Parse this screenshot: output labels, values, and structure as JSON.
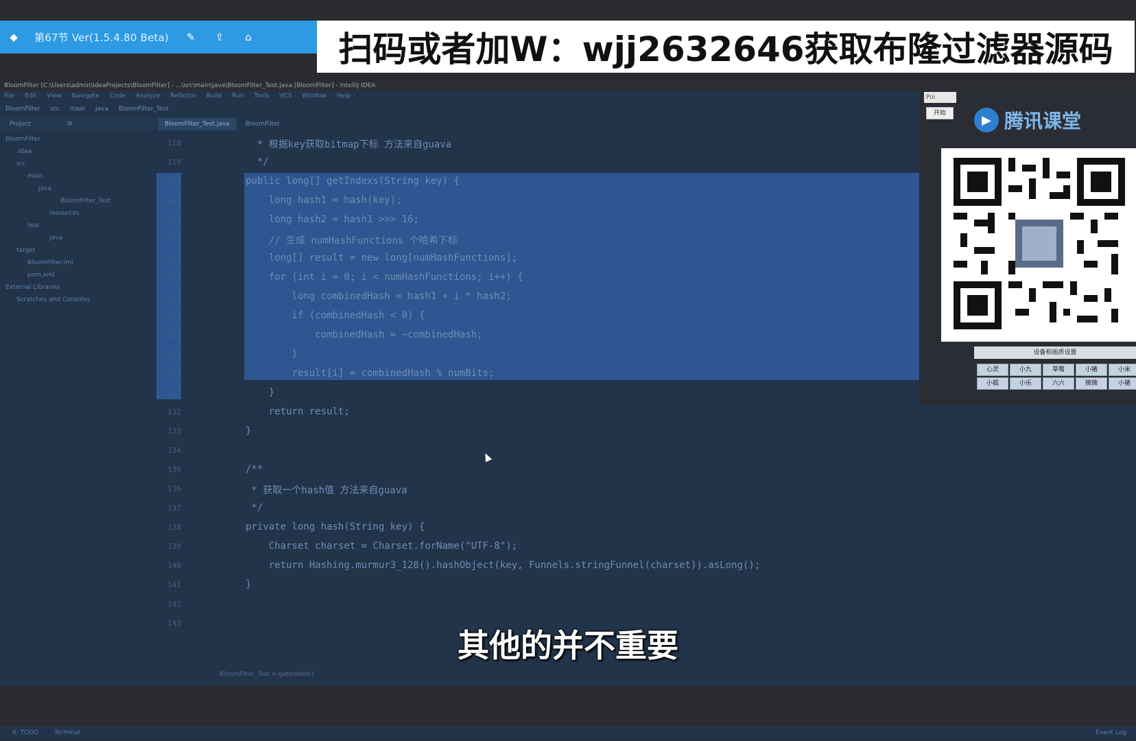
{
  "player": {
    "title": "第67节 Ver(1.5.4.80 Beta)",
    "icons": [
      "app-icon",
      "edit-icon",
      "share-icon",
      "home-icon"
    ]
  },
  "promo": {
    "text": "扫码或者加W：wjj2632646获取布隆过滤器源码"
  },
  "ide": {
    "window_title": "BloomFilter [C:\\Users\\admin\\IdeaProjects\\BloomFilter] - ...\\src\\main\\java\\BloomFilter_Test.java [BloomFilter] - IntelliJ IDEA",
    "menu": [
      "File",
      "Edit",
      "View",
      "Navigate",
      "Code",
      "Analyze",
      "Refactor",
      "Build",
      "Run",
      "Tools",
      "VCS",
      "Window",
      "Help"
    ],
    "breadcrumbs": [
      "BloomFilter",
      "src",
      "main",
      "java",
      "BloomFilter_Test"
    ],
    "project_header": "Project",
    "tabs": [
      {
        "label": "BloomFilter_Test.java",
        "active": true
      },
      {
        "label": "BloomFilter",
        "active": false
      }
    ],
    "tree": [
      {
        "label": "BloomFilter",
        "depth": 0
      },
      {
        "label": ".idea",
        "depth": 1
      },
      {
        "label": "src",
        "depth": 1
      },
      {
        "label": "main",
        "depth": 2
      },
      {
        "label": "java",
        "depth": 3
      },
      {
        "label": "BloomFilter_Test",
        "depth": 4
      },
      {
        "label": "resources",
        "depth": 3
      },
      {
        "label": "test",
        "depth": 2
      },
      {
        "label": "java",
        "depth": 3
      },
      {
        "label": "target",
        "depth": 1
      },
      {
        "label": "BloomFilter.iml",
        "depth": 1
      },
      {
        "label": "pom.xml",
        "depth": 1
      },
      {
        "label": "External Libraries",
        "depth": 0
      },
      {
        "label": "Scratches and Consoles",
        "depth": 0
      }
    ],
    "line_numbers": [
      "118",
      "119",
      "120",
      "121",
      "122",
      "123",
      "124",
      "125",
      "126",
      "127",
      "128",
      "129",
      "130",
      "131",
      "132",
      "133",
      "134",
      "135",
      "136",
      "137",
      "138",
      "139",
      "140",
      "141",
      "142",
      "143"
    ],
    "code_lines": [
      "  * 根据key获取bitmap下标 方法来自guava",
      "  */",
      "public long[] getIndexs(String key) {",
      "    long hash1 = hash(key);",
      "    long hash2 = hash1 >>> 16;",
      "    // 生成 numHashFunctions 个哈希下标",
      "    long[] result = new long[numHashFunctions];",
      "    for (int i = 0; i < numHashFunctions; i++) {",
      "        long combinedHash = hash1 + i * hash2;",
      "        if (combinedHash < 0) {",
      "            combinedHash = ~combinedHash;",
      "        }",
      "        result[i] = combinedHash % numBits;",
      "    }",
      "    return result;",
      "}",
      "",
      "/**",
      " * 获取一个hash值 方法来自guava",
      " */",
      "private long hash(String key) {",
      "    Charset charset = Charset.forName(\"UTF-8\");",
      "    return Hashing.murmur3_128().hashObject(key, Funnels.stringFunnel(charset)).asLong();",
      "}",
      "",
      ""
    ],
    "editor_breadcrumb": "BloomFilter_Test > getIndexs()",
    "bottom_tools": [
      "6: TODO",
      "Terminal"
    ],
    "event_log": "Event Log"
  },
  "right_panel": {
    "poi_label": "Poi",
    "start_button": "开始",
    "brand": "腾讯课堂",
    "settings_label": "设备和画质设置",
    "grid_buttons": [
      "心灵",
      "小九",
      "草莓",
      "小猪",
      "小狐",
      "小乐",
      "六六",
      "微微",
      "小猪",
      "小米"
    ]
  },
  "subtitle": "其他的并不重要"
}
